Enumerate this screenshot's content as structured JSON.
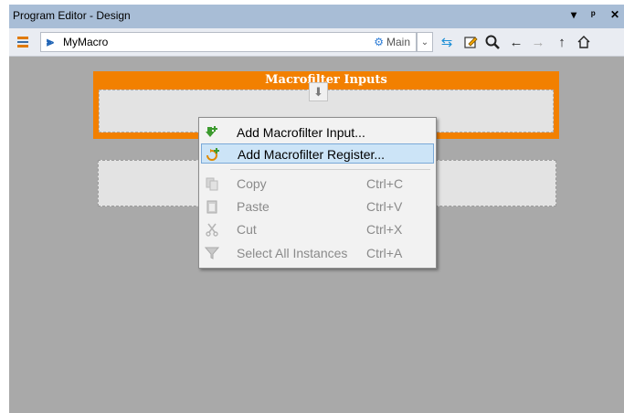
{
  "window": {
    "title": "Program Editor - Design",
    "controls": {
      "dropdown": "▾",
      "pin": "ᵖ",
      "close": "✕"
    }
  },
  "toolbar": {
    "macro_name": "MyMacro",
    "variant_label": "Main",
    "icons": [
      "list-icon",
      "macro-icon",
      "main-gear-icon",
      "dropdown-icon",
      "swap-icon",
      "edit-icon",
      "search-icon",
      "back-arrow-icon",
      "forward-arrow-icon",
      "up-arrow-icon",
      "home-icon"
    ]
  },
  "canvas": {
    "inputs_header": "Macrofilter Inputs",
    "down_arrow_glyph": "⬇"
  },
  "context_menu": {
    "items": [
      {
        "label": "Add Macrofilter Input...",
        "shortcut": "",
        "icon": "add-input-icon",
        "enabled": true,
        "highlighted": false
      },
      {
        "label": "Add Macrofilter Register...",
        "shortcut": "",
        "icon": "add-register-icon",
        "enabled": true,
        "highlighted": true
      },
      {
        "label": "Copy",
        "shortcut": "Ctrl+C",
        "icon": "copy-icon",
        "enabled": false,
        "highlighted": false
      },
      {
        "label": "Paste",
        "shortcut": "Ctrl+V",
        "icon": "paste-icon",
        "enabled": false,
        "highlighted": false
      },
      {
        "label": "Cut",
        "shortcut": "Ctrl+X",
        "icon": "cut-icon",
        "enabled": false,
        "highlighted": false
      },
      {
        "label": "Select All Instances",
        "shortcut": "Ctrl+A",
        "icon": "select-all-instances-icon",
        "enabled": false,
        "highlighted": false
      }
    ]
  },
  "colors": {
    "titlebar": "#a8bdd6",
    "canvas_bg": "#a9a9a9",
    "inputs_accent": "#f28000",
    "menu_highlight": "#cce4f7"
  }
}
